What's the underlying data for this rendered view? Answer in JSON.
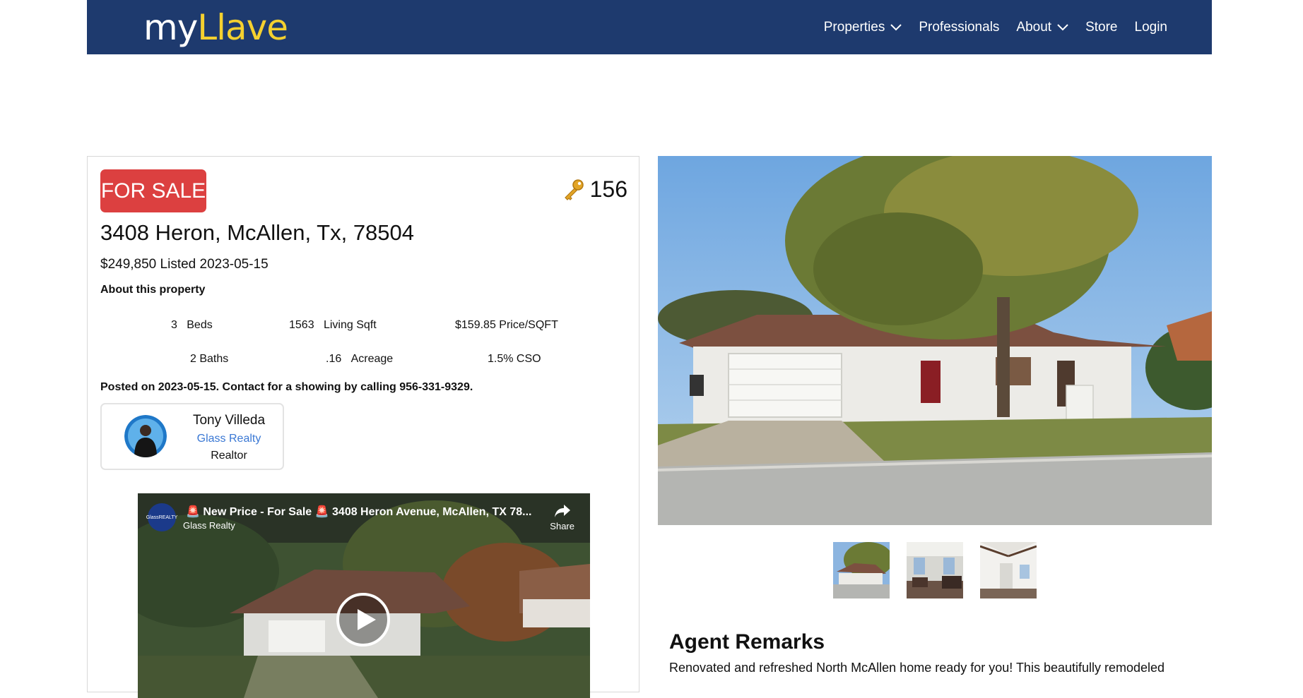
{
  "brand": {
    "part1": "my",
    "part2": "Llave"
  },
  "nav": {
    "properties": "Properties",
    "professionals": "Professionals",
    "about": "About",
    "store": "Store",
    "login": "Login"
  },
  "listing": {
    "status_badge": "FOR SALE",
    "keys_count": "156",
    "address": "3408 Heron, McAllen, Tx, 78504",
    "price_line": "$249,850 Listed 2023-05-15",
    "about_heading": "About this property",
    "stats": {
      "beds_value": "3",
      "beds_label": "Beds",
      "sqft_value": "1563",
      "sqft_label": "Living Sqft",
      "price_sqft": "$159.85 Price/SQFT",
      "baths": "2 Baths",
      "acreage_value": ".16",
      "acreage_label": "Acreage",
      "cso": "1.5% CSO"
    },
    "posted": "Posted on 2023-05-15. Contact for a showing by calling 956-331-9329."
  },
  "agent": {
    "name": "Tony Villeda",
    "company": "Glass Realty",
    "role": "Realtor"
  },
  "video": {
    "title": "🚨 New Price - For Sale 🚨 3408 Heron Avenue, McAllen, TX 78...",
    "channel": "Glass Realty",
    "share_label": "Share",
    "logo_text": "GlassREALTY"
  },
  "remarks": {
    "heading": "Agent Remarks",
    "text": "Renovated and refreshed North McAllen home ready for you! This beautifully remodeled"
  },
  "colors": {
    "navbar": "#1e3a6e",
    "brand_accent": "#f4d02f",
    "badge": "#dc4040",
    "link": "#3a78d4"
  },
  "icons": {
    "keys": "key-icon",
    "play": "play-icon",
    "share": "share-icon",
    "dropdown": "chevron-down-icon"
  }
}
